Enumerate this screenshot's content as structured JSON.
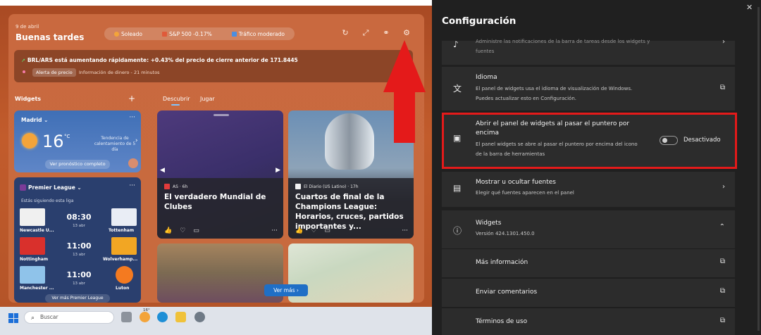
{
  "widgets_panel": {
    "date": "9 de abril",
    "greeting": "Buenas tardes",
    "status_pills": [
      {
        "label": "Soleado",
        "color": "#f3a43a"
      },
      {
        "label": "S&P 500 -0.17%",
        "color": "#e05a3a"
      },
      {
        "label": "Tráfico moderado",
        "color": "#4c8ee0"
      }
    ],
    "banner": {
      "headline_prefix": "BRL/ARS está aumentando rápidamente: ",
      "headline_rest": "+0.43% del precio de cierre anterior de 171.8445",
      "tag": "Alerta de precio",
      "info": "Información de dinero - 21 minutos"
    },
    "widgets_label": "Widgets",
    "tabs": [
      "Descubrir",
      "Jugar"
    ],
    "weather": {
      "city": "Madrid",
      "temp": "16",
      "unit": "°C",
      "trend": "Tendencia de calentamiento de 5 día",
      "forecast_btn": "Ver pronóstico completo"
    },
    "league": {
      "name": "Premier League",
      "subtitle": "Estás siguiendo esta liga",
      "matches": [
        {
          "home": "Newcastle U...",
          "away": "Tottenham",
          "time": "08:30",
          "date": "13 abr",
          "home_color": "#f0f0f0",
          "away_color": "#e9edf5"
        },
        {
          "home": "Nottingham",
          "away": "Wolverhamp...",
          "time": "11:00",
          "date": "13 abr",
          "home_color": "#d9302c",
          "away_color": "#f2a623"
        },
        {
          "home": "Manchester ...",
          "away": "Luton",
          "time": "11:00",
          "date": "13 abr",
          "home_color": "#8fc3ea",
          "away_color": "#f47a20"
        }
      ],
      "footer": "Ver más Premier League"
    },
    "cards": [
      {
        "source": "AS · 6h",
        "title": "El verdadero Mundial de Clubes"
      },
      {
        "source": "El Diario (US Latino) · 17h",
        "title": "Cuartos de final de la Champions League: Horarios, cruces, partidos importantes y..."
      }
    ],
    "ver_mas": "Ver más",
    "taskbar": {
      "search_placeholder": "Buscar",
      "weather_badge": "16°"
    }
  },
  "settings": {
    "title": "Configuración",
    "items": [
      {
        "title": "",
        "desc": "Administre las notificaciones de la barra de tareas desde los widgets y fuentes",
        "action": "chevron"
      },
      {
        "title": "Idioma",
        "desc": "El panel de widgets usa el idioma de visualización de Windows. Puedes actualizar esto en Configuración.",
        "action": "external"
      },
      {
        "title": "Abrir el panel de widgets al pasar el puntero por encima",
        "desc": "El panel widgets se abre al pasar el puntero por encima del icono de la barra de herramientas",
        "toggle_label": "Desactivado"
      },
      {
        "title": "Mostrar u ocultar fuentes",
        "desc": "Elegir qué fuentes aparecen en el panel",
        "action": "chevron"
      },
      {
        "title": "Widgets",
        "desc": "Versión 424.1301.450.0",
        "action": "chevron-up"
      },
      {
        "title": "Más información",
        "action": "external"
      },
      {
        "title": "Enviar comentarios",
        "action": "external"
      },
      {
        "title": "Términos de uso",
        "action": "external"
      }
    ]
  },
  "colors": {
    "highlight": "#e41a1a",
    "accent": "#1f6fc6"
  }
}
